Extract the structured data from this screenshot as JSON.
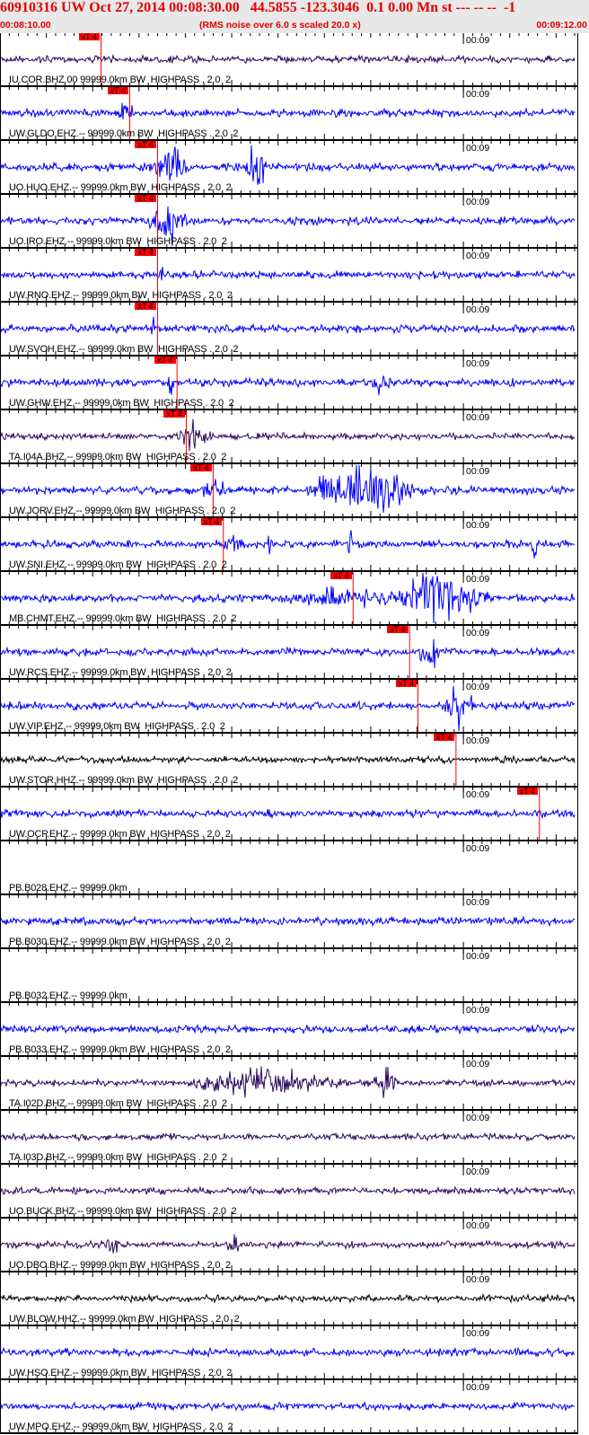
{
  "header": {
    "title": "60910316 UW Oct 27, 2014 00:08:30.00   44.5855 -123.3046  0.1 0.00 Mn st --- -- --  -1",
    "start_time": "00:08:10.00",
    "end_time": "00:09:12.00",
    "note": "(RMS noise over 6.0 s scaled 20.0 x)"
  },
  "window_seconds": 62,
  "minute_label": "00:09",
  "minute_offset_s": 50,
  "pick_label": "xT 4",
  "colors": {
    "blue": "#0000ff",
    "purple": "#2a0a5c",
    "black": "#000000",
    "pick": "#ff0000",
    "header_text": "#e00000"
  },
  "traces": [
    {
      "label": "IU.COR.BHZ.00 99999.0km BW  HIGHPASS . 2.0  2",
      "color": "purple",
      "pick_s": 10.9
    },
    {
      "label": "UW.GLDO.EHZ.-- 99999.0km BW  HIGHPASS . 2.0  2",
      "color": "blue",
      "pick_s": 14.0
    },
    {
      "label": "UO.HUO.EHZ.-- 99999.0km BW  HIGHPASS . 2.0  2",
      "color": "blue",
      "pick_s": 17.0
    },
    {
      "label": "UO.IRO.EHZ.-- 99999.0km BW  HIGHPASS . 2.0  2",
      "color": "blue",
      "pick_s": 17.0
    },
    {
      "label": "UW.RNO.EHZ.-- 99999.0km BW  HIGHPASS . 2.0  2",
      "color": "blue",
      "pick_s": 17.0
    },
    {
      "label": "UW.SVOH.EHZ.-- 99999.0km BW  HIGHPASS . 2.0  2",
      "color": "blue",
      "pick_s": 17.0
    },
    {
      "label": "UW.GHW.EHZ.-- 99999.0km BW  HIGHPASS . 2.0  2",
      "color": "blue",
      "pick_s": 19.1
    },
    {
      "label": "TA.I04A.BHZ.-- 99999.0km BW  HIGHPASS . 2.0  2",
      "color": "purple",
      "pick_s": 20.1
    },
    {
      "label": "UW.JORV.EHZ.-- 99999.0km BW  HIGHPASS . 2.0  2",
      "color": "blue",
      "pick_s": 23.0
    },
    {
      "label": "UW.SNI.EHZ.-- 99999.0km BW  HIGHPASS . 2.0  2",
      "color": "blue",
      "pick_s": 24.1
    },
    {
      "label": "MB.CHMT.EHZ.-- 99999.0km BW  HIGHPASS . 2.0  2",
      "color": "blue",
      "pick_s": 38.1
    },
    {
      "label": "UW.RCS.EHZ.-- 99999.0km BW  HIGHPASS . 2.0  2",
      "color": "blue",
      "pick_s": 44.2
    },
    {
      "label": "UW.VIP.EHZ.-- 99999.0km BW  HIGHPASS . 2.0  2",
      "color": "blue",
      "pick_s": 45.1
    },
    {
      "label": "UW.STOR.HHZ.-- 99999.0km BW  HIGHPASS . 2.0  2",
      "color": "black",
      "pick_s": 49.2
    },
    {
      "label": "UW.OCP.EHZ.-- 99999.0km BW  HIGHPASS . 2.0  2",
      "color": "blue",
      "pick_s": 58.2
    },
    {
      "label": "PB.B028.EHZ.-- 99999.0km",
      "color": "blue",
      "pick_s": null,
      "empty": true
    },
    {
      "label": "PB.B030.EHZ.-- 99999.0km BW  HIGHPASS . 2.0  2",
      "color": "blue",
      "pick_s": null
    },
    {
      "label": "PB.B032.EHZ.-- 99999.0km",
      "color": "blue",
      "pick_s": null,
      "empty": true
    },
    {
      "label": "PB.B033.EHZ.-- 99999.0km BW  HIGHPASS . 2.0  2",
      "color": "blue",
      "pick_s": null
    },
    {
      "label": "TA.I02D.BHZ.-- 99999.0km BW  HIGHPASS . 2.0  2",
      "color": "purple",
      "pick_s": null
    },
    {
      "label": "TA.I03D.BHZ.-- 99999.0km BW  HIGHPASS . 2.0  2",
      "color": "purple",
      "pick_s": null
    },
    {
      "label": "UO.BUCK.BHZ.-- 99999.0km BW  HIGHPASS . 2.0  2",
      "color": "purple",
      "pick_s": null
    },
    {
      "label": "UO.DBO.BHZ.-- 99999.0km BW  HIGHPASS . 2.0  2",
      "color": "purple",
      "pick_s": null
    },
    {
      "label": "UW.BLOW.HHZ.-- 99999.0km BW  HIGHPASS . 2.0  2",
      "color": "black",
      "pick_s": null
    },
    {
      "label": "UW.HSO.EHZ.-- 99999.0km BW  HIGHPASS . 2.0  2",
      "color": "blue",
      "pick_s": null
    },
    {
      "label": "UW.MPO.EHZ.-- 99999.0km BW  HIGHPASS . 2.0  2",
      "color": "blue",
      "pick_s": null
    }
  ]
}
